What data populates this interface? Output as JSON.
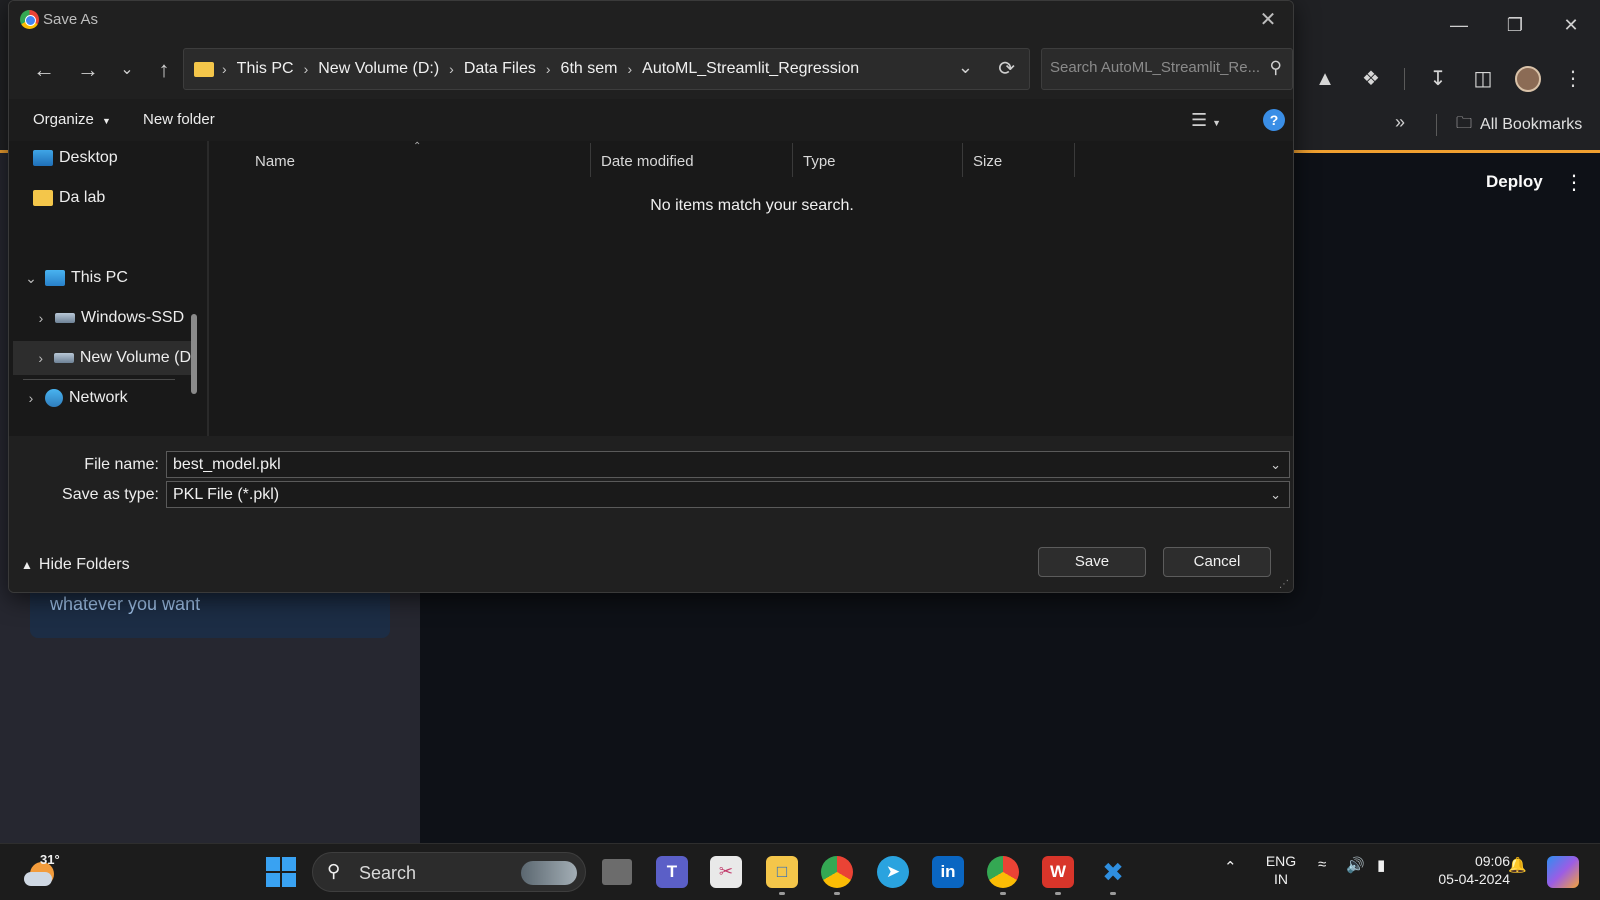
{
  "browser": {
    "bookmarks_label": "All Bookmarks",
    "deploy_label": "Deploy"
  },
  "streamlit": {
    "card_text": "whatever you want"
  },
  "dialog": {
    "title": "Save As",
    "breadcrumb": [
      "This PC",
      "New Volume (D:)",
      "Data Files",
      "6th sem",
      "AutoML_Streamlit_Regression"
    ],
    "search_placeholder": "Search AutoML_Streamlit_Re...",
    "organize_label": "Organize",
    "new_folder_label": "New folder",
    "help_label": "?",
    "nav": {
      "desktop": "Desktop",
      "da_lab": "Da lab",
      "this_pc": "This PC",
      "windows_ssd": "Windows-SSD",
      "new_volume": "New Volume (D",
      "network": "Network"
    },
    "columns": {
      "name": "Name",
      "date_modified": "Date modified",
      "type": "Type",
      "size": "Size"
    },
    "empty_message": "No items match your search.",
    "file_name_label": "File name:",
    "file_name_value": "best_model.pkl",
    "save_type_label": "Save as type:",
    "save_type_value": "PKL File (*.pkl)",
    "hide_folders_label": "Hide Folders",
    "save_label": "Save",
    "cancel_label": "Cancel"
  },
  "taskbar": {
    "weather_temp": "31°",
    "search_label": "Search",
    "lang_top": "ENG",
    "lang_bottom": "IN",
    "time": "09:06",
    "date": "05-04-2024",
    "apps": [
      "task-view",
      "teams",
      "snipping-tool",
      "file-explorer",
      "chrome",
      "telegram",
      "linkedin",
      "chrome-profile",
      "wps-office",
      "vscode"
    ]
  },
  "colors": {
    "accent": "#f0a030",
    "help": "#3a8ee6",
    "folder": "#f4c64a"
  }
}
